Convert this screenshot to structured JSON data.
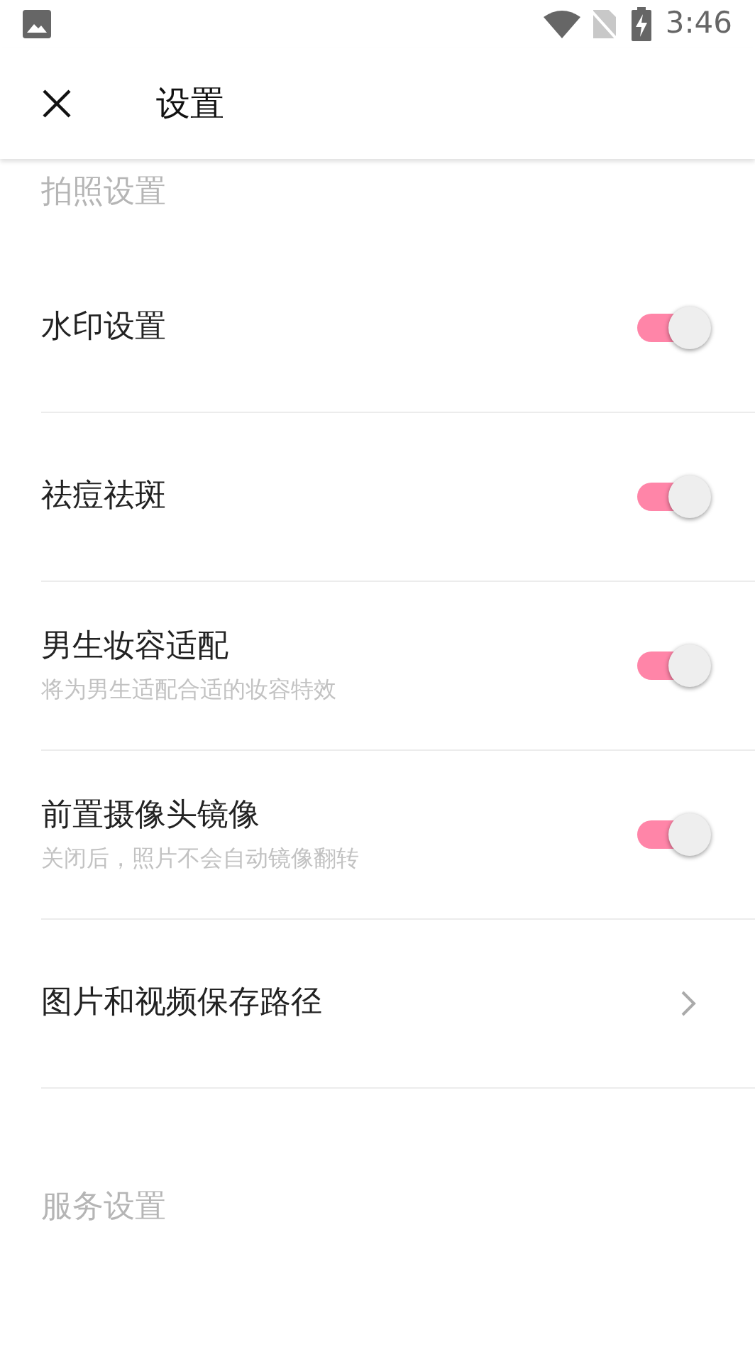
{
  "status_bar": {
    "time": "3:46"
  },
  "app_bar": {
    "title": "设置"
  },
  "sections": [
    {
      "title": "拍照设置",
      "items": [
        {
          "kind": "toggle",
          "label": "水印设置",
          "on": true
        },
        {
          "kind": "toggle",
          "label": "祛痘祛斑",
          "on": true
        },
        {
          "kind": "toggle",
          "label": "男生妆容适配",
          "description": "将为男生适配合适的妆容特效",
          "on": true
        },
        {
          "kind": "toggle",
          "label": "前置摄像头镜像",
          "description": "关闭后，照片不会自动镜像翻转",
          "on": true
        },
        {
          "kind": "link",
          "label": "图片和视频保存路径"
        }
      ]
    },
    {
      "title": "服务设置"
    }
  ]
}
